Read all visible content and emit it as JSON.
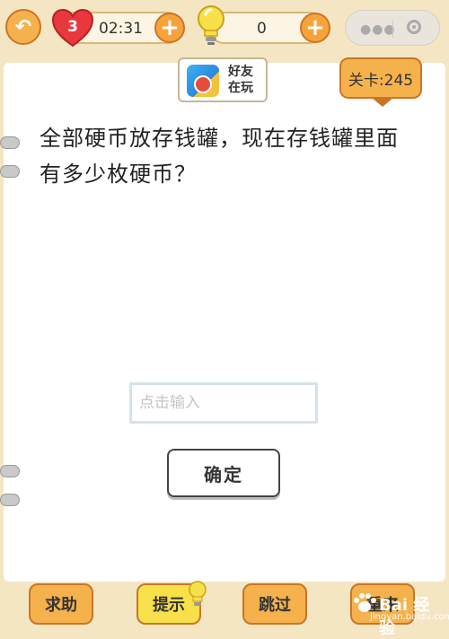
{
  "header": {
    "lives": "3",
    "timer": "02:31",
    "hints": "0"
  },
  "friends_badge": {
    "label_line1": "好友",
    "label_line2": "在玩"
  },
  "level": {
    "label": "关卡:245"
  },
  "question": {
    "line1": "全部硬币放存钱罐，现在存钱罐里面",
    "line2": "有多少枚硬币？"
  },
  "answer": {
    "placeholder": "点击输入",
    "value": ""
  },
  "confirm_label": "确定",
  "bottom_bar": {
    "help_label": "求助",
    "hint_label": "提示",
    "skip_label": "跳过",
    "restart_label": "重来"
  },
  "watermark": {
    "text": "Bai 经验",
    "url": "jingyan.baidu.com"
  },
  "colors": {
    "background": "#f4e6c2",
    "accent_orange": "#f5b24c",
    "accent_yellow": "#f7e04a",
    "heart_red": "#e8383d",
    "border_brown": "#c8752a"
  },
  "icons": [
    "back-arrow-icon",
    "heart-icon",
    "plus-icon",
    "lightbulb-icon",
    "more-dots-icon",
    "close-target-icon",
    "app-icon"
  ]
}
